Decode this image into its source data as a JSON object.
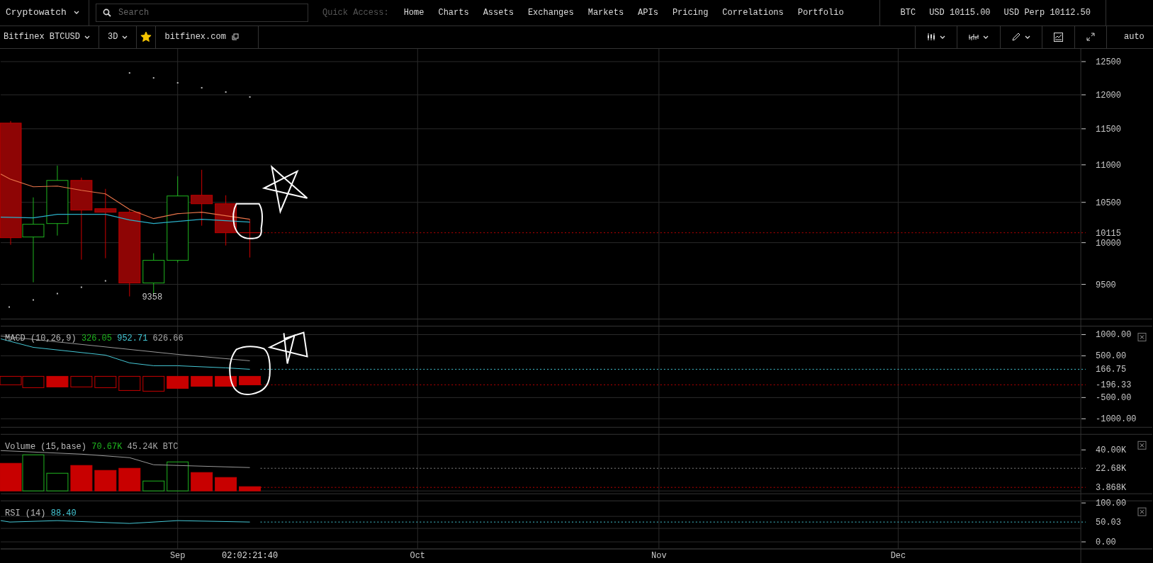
{
  "header": {
    "brand": "Cryptowatch",
    "search": {
      "placeholder": "Search"
    },
    "quick_access_label": "Quick Access:",
    "links": [
      "Home",
      "Charts",
      "Assets",
      "Exchanges",
      "Markets",
      "APIs",
      "Pricing",
      "Correlations",
      "Portfolio"
    ],
    "ticker": {
      "symbol": "BTC",
      "prices": [
        "USD 10115.00",
        "USD Perp 10112.50"
      ]
    }
  },
  "toolbar": {
    "market": "Bitfinex BTCUSD",
    "period": "3D",
    "favorite": true,
    "exchange_link": "bitfinex.com",
    "scale": "auto"
  },
  "price_chart": {
    "y_labels": [
      "12500",
      "12000",
      "11500",
      "11000",
      "10500",
      "10115",
      "10000",
      "9500"
    ],
    "low_label": "9358"
  },
  "indicators": [
    {
      "kind": "macd",
      "label": "MACD (10,26,9)",
      "values": [
        {
          "text": "326.05",
          "color": "#1fb51f"
        },
        {
          "text": "952.71",
          "color": "#45c8d6"
        },
        {
          "text": "626.66",
          "color": "#aaaaaa"
        }
      ],
      "y_labels": [
        "1000.00",
        "500.00",
        "166.75",
        "-196.33",
        "-500.00",
        "-1000.00"
      ]
    },
    {
      "kind": "volume",
      "label": "Volume (15,base)",
      "values": [
        {
          "text": "70.67K",
          "color": "#1fb51f"
        },
        {
          "text": "45.24K BTC",
          "color": "#aaaaaa"
        }
      ],
      "y_labels": [
        "40.00K",
        "22.68K",
        "3.868K"
      ]
    },
    {
      "kind": "rsi",
      "label": "RSI (14)",
      "values": [
        {
          "text": "88.40",
          "color": "#45c8d6"
        }
      ],
      "y_labels": [
        "100.00",
        "50.03",
        "0.00"
      ]
    }
  ],
  "x_labels": [
    "Sep",
    "02:02:21:40",
    "Oct",
    "Nov",
    "Dec"
  ]
}
